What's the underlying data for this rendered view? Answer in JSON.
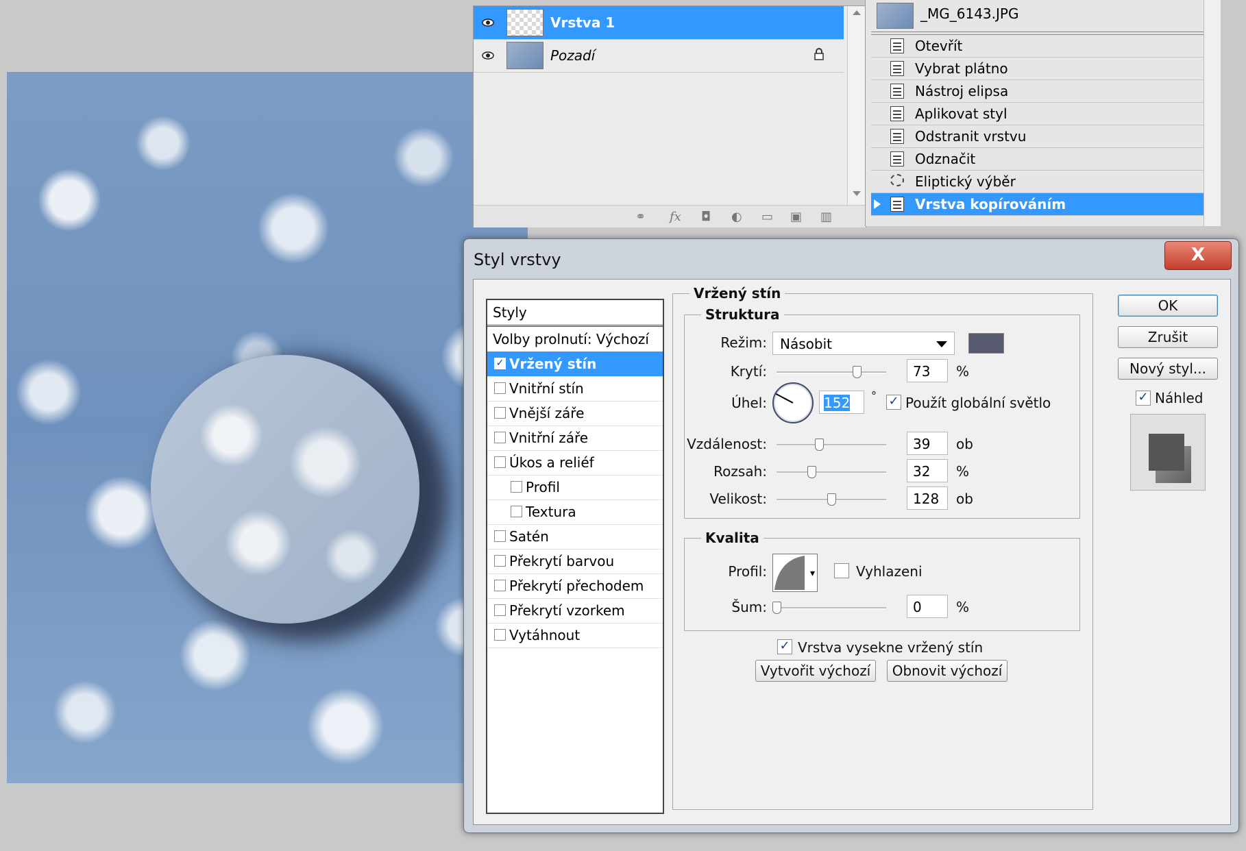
{
  "layers": {
    "items": [
      {
        "name": "Vrstva 1",
        "selected": true
      },
      {
        "name": "Pozadí",
        "locked": true
      }
    ],
    "footer_icons": [
      "link-icon",
      "fx-icon",
      "mask-icon",
      "adjustment-icon",
      "folder-icon",
      "new-layer-icon",
      "trash-icon"
    ],
    "fx_glyph": "fx"
  },
  "history": {
    "snapshot": "_MG_6143.JPG",
    "items": [
      {
        "label": "Otevřít"
      },
      {
        "label": "Vybrat plátno"
      },
      {
        "label": "Nástroj elipsa"
      },
      {
        "label": "Aplikovat styl"
      },
      {
        "label": "Odstranit vrstvu"
      },
      {
        "label": "Odznačit"
      },
      {
        "label": "Eliptický výběr"
      },
      {
        "label": "Vrstva kopírováním",
        "selected": true
      }
    ]
  },
  "dialog": {
    "title": "Styl vrstvy",
    "close": "X",
    "styles_header": "Styly",
    "styles": [
      {
        "label": "Volby prolnutí: Výchozí"
      },
      {
        "label": "Vržený stín",
        "checked": true,
        "active": true
      },
      {
        "label": "Vnitřní stín",
        "checked": false
      },
      {
        "label": "Vnější záře",
        "checked": false
      },
      {
        "label": "Vnitřní záře",
        "checked": false
      },
      {
        "label": "Úkos a reliéf",
        "checked": false
      },
      {
        "label": "Profil",
        "checked": false,
        "indent": true
      },
      {
        "label": "Textura",
        "checked": false,
        "indent": true
      },
      {
        "label": "Satén",
        "checked": false
      },
      {
        "label": "Překrytí barvou",
        "checked": false
      },
      {
        "label": "Překrytí přechodem",
        "checked": false
      },
      {
        "label": "Překrytí vzorkem",
        "checked": false
      },
      {
        "label": "Vytáhnout",
        "checked": false
      }
    ],
    "section_title": "Vržený stín",
    "structure": {
      "title": "Struktura",
      "mode_label": "Režim:",
      "mode_value": "Násobit",
      "shadow_color": "#575a6e",
      "opacity_label": "Krytí:",
      "opacity_value": "73",
      "opacity_unit": "%",
      "angle_label": "Úhel:",
      "angle_value": "152",
      "angle_unit": "°",
      "global_light_label": "Použít globální světlo",
      "global_light_checked": true,
      "distance_label": "Vzdálenost:",
      "distance_value": "39",
      "distance_unit": "ob",
      "spread_label": "Rozsah:",
      "spread_value": "32",
      "spread_unit": "%",
      "size_label": "Velikost:",
      "size_value": "128",
      "size_unit": "ob",
      "slider_levels": {
        "opacity": 0.73,
        "distance": 0.39,
        "spread": 0.32,
        "size": 0.5
      }
    },
    "quality": {
      "title": "Kvalita",
      "contour_label": "Profil:",
      "antialias_label": "Vyhlazeni",
      "antialias_checked": false,
      "noise_label": "Šum:",
      "noise_value": "0",
      "noise_unit": "%",
      "noise_level": 0
    },
    "knockout_label": "Vrstva vysekne vržený stín",
    "knockout_checked": true,
    "make_default": "Vytvořit výchozí",
    "reset_default": "Obnovit výchozí",
    "ok": "OK",
    "cancel": "Zrušit",
    "new_style": "Nový styl...",
    "preview_label": "Náhled",
    "preview_checked": true,
    "check_glyph": "✓",
    "lock_glyph": "🔒",
    "dropdown_glyph": "▾"
  }
}
